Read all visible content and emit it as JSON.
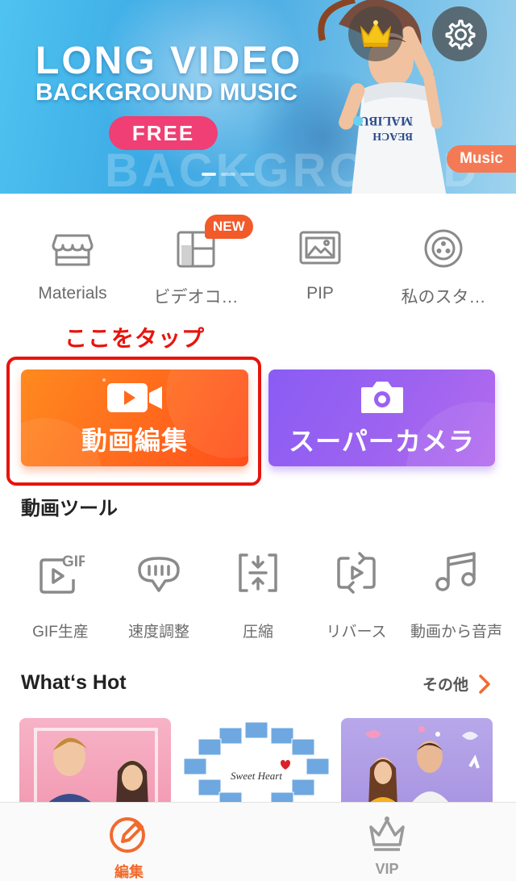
{
  "banner": {
    "title_line1": "LONG VIDEO",
    "title_line2": "BACKGROUND MUSIC",
    "free_label": "FREE",
    "bg_word": "BACKGROUND",
    "music_tag": "Music",
    "crown_icon": "crown-icon",
    "settings_icon": "gear-icon",
    "accent": "#ef3f74"
  },
  "quick_menu": [
    {
      "label": "Materials",
      "icon": "store-icon"
    },
    {
      "label": "ビデオコ…",
      "icon": "collage-icon",
      "badge": "NEW"
    },
    {
      "label": "PIP",
      "icon": "picture-in-picture-icon"
    },
    {
      "label": "私のスタ…",
      "icon": "my-studio-icon"
    }
  ],
  "hint": {
    "text": "ここをタップ",
    "color": "#e8140c"
  },
  "main_actions": {
    "edit_label": "動画編集",
    "camera_label": "スーパーカメラ"
  },
  "tools": {
    "title": "動画ツール",
    "items": [
      {
        "label": "GIF生産",
        "icon": "gif-icon"
      },
      {
        "label": "速度調整",
        "icon": "speed-gauge-icon"
      },
      {
        "label": "圧縮",
        "icon": "compress-icon"
      },
      {
        "label": "リバース",
        "icon": "reverse-icon"
      },
      {
        "label": "動画から音声",
        "icon": "music-note-icon"
      }
    ]
  },
  "hot": {
    "title": "What‘s Hot",
    "more_label": "その他",
    "thumb2_caption": "Sweet Heart"
  },
  "tabbar": {
    "edit_label": "編集",
    "vip_label": "VIP",
    "active_color": "#f26a2e",
    "inactive_color": "#9a9a9a"
  }
}
